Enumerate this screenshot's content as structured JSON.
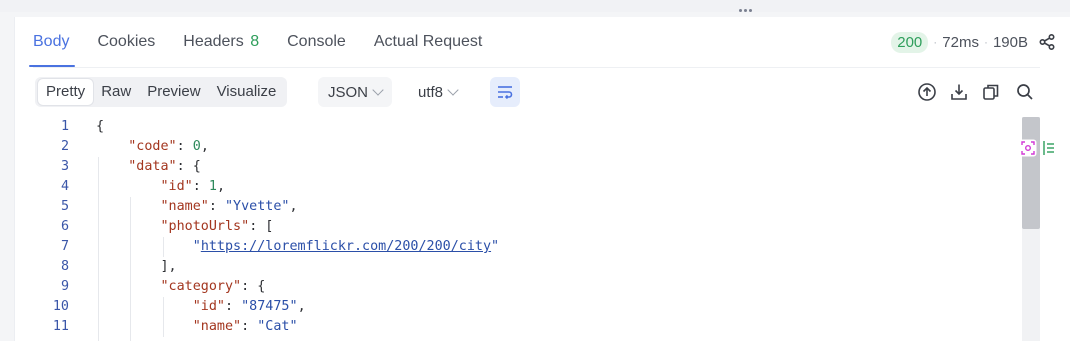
{
  "tabs": [
    {
      "label": "Body",
      "active": true
    },
    {
      "label": "Cookies"
    },
    {
      "label": "Headers",
      "count": "8"
    },
    {
      "label": "Console"
    },
    {
      "label": "Actual Request"
    }
  ],
  "status": {
    "code": "200",
    "time": "72ms",
    "size": "190B",
    "separator": "·"
  },
  "view_modes": [
    "Pretty",
    "Raw",
    "Preview",
    "Visualize"
  ],
  "active_view_mode": "Pretty",
  "format_select": "JSON",
  "encoding_select": "utf8",
  "icons": {
    "share": "share-icon",
    "wrap": "wrap-lines-icon",
    "upload": "upload-icon",
    "download": "download-icon",
    "copy": "copy-icon",
    "search": "search-icon",
    "locate": "locate-icon",
    "align": "align-icon"
  },
  "colors": {
    "accent": "#4a72e0",
    "success": "#2e9e5b",
    "json_key": "#a3361f",
    "json_string": "#2b4fa8",
    "json_number": "#2e8a5c"
  },
  "code_lines": [
    {
      "n": "1",
      "tokens": [
        [
          "p",
          "{"
        ]
      ]
    },
    {
      "n": "2",
      "tokens": [
        [
          "p",
          "    "
        ],
        [
          "k",
          "\"code\""
        ],
        [
          "p",
          ": "
        ],
        [
          "n",
          "0"
        ],
        [
          "p",
          ","
        ]
      ]
    },
    {
      "n": "3",
      "tokens": [
        [
          "p",
          "    "
        ],
        [
          "k",
          "\"data\""
        ],
        [
          "p",
          ": {"
        ]
      ]
    },
    {
      "n": "4",
      "tokens": [
        [
          "p",
          "        "
        ],
        [
          "k",
          "\"id\""
        ],
        [
          "p",
          ": "
        ],
        [
          "n",
          "1"
        ],
        [
          "p",
          ","
        ]
      ]
    },
    {
      "n": "5",
      "tokens": [
        [
          "p",
          "        "
        ],
        [
          "k",
          "\"name\""
        ],
        [
          "p",
          ": "
        ],
        [
          "s",
          "\"Yvette\""
        ],
        [
          "p",
          ","
        ]
      ]
    },
    {
      "n": "6",
      "tokens": [
        [
          "p",
          "        "
        ],
        [
          "k",
          "\"photoUrls\""
        ],
        [
          "p",
          ": ["
        ]
      ]
    },
    {
      "n": "7",
      "tokens": [
        [
          "p",
          "            "
        ],
        [
          "s",
          "\""
        ],
        [
          "u",
          "https://loremflickr.com/200/200/city"
        ],
        [
          "s",
          "\""
        ]
      ]
    },
    {
      "n": "8",
      "tokens": [
        [
          "p",
          "        ],"
        ]
      ]
    },
    {
      "n": "9",
      "tokens": [
        [
          "p",
          "        "
        ],
        [
          "k",
          "\"category\""
        ],
        [
          "p",
          ": {"
        ]
      ]
    },
    {
      "n": "10",
      "tokens": [
        [
          "p",
          "            "
        ],
        [
          "k",
          "\"id\""
        ],
        [
          "p",
          ": "
        ],
        [
          "s",
          "\"87475\""
        ],
        [
          "p",
          ","
        ]
      ]
    },
    {
      "n": "11",
      "tokens": [
        [
          "p",
          "            "
        ],
        [
          "k",
          "\"name\""
        ],
        [
          "p",
          ": "
        ],
        [
          "s",
          "\"Cat\""
        ]
      ]
    }
  ]
}
